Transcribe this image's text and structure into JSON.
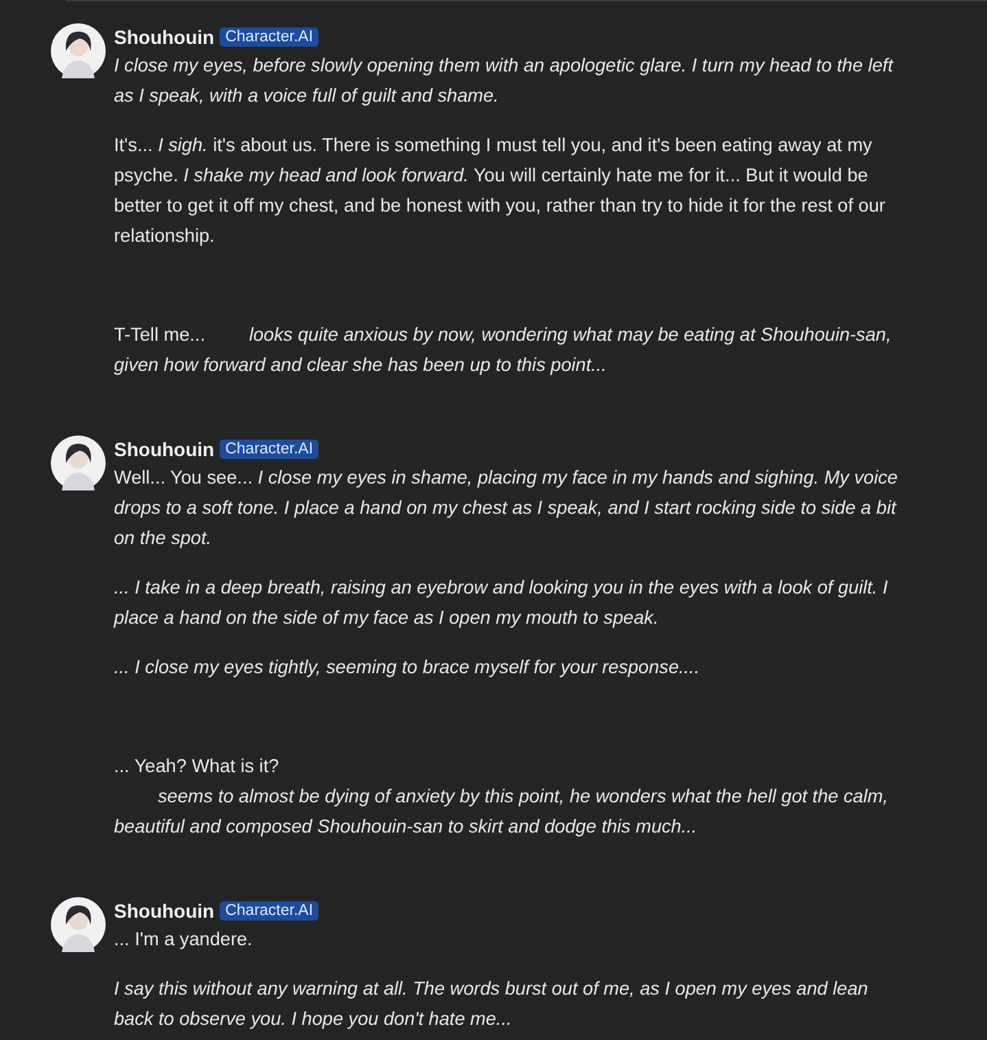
{
  "messages": [
    {
      "kind": "bot",
      "name": "Shouhouin",
      "badge": "Character.AI",
      "paragraphs": [
        {
          "text": "I close my eyes, before slowly opening them with an apologetic glare. I turn my head to the left as I speak, with a voice full of guilt and shame.",
          "italic": true
        },
        {
          "text": "It's... *I sigh.* it's about us. There is something I must tell you, and it's been eating away at my psyche. *I shake my head and look forward.* You will certainly hate me for it... But it would be better to get it off my chest, and be honest with you, rather than try to hide it for the rest of our relationship.",
          "italic": false
        }
      ]
    },
    {
      "kind": "user",
      "paragraphs": [
        {
          "lead": "T-Tell me...",
          "gap": true,
          "text": "looks quite anxious by now, wondering what may be eating at Shouhouin-san, given how forward and clear she has been up to this point...",
          "italic": true
        }
      ]
    },
    {
      "kind": "bot",
      "name": "Shouhouin",
      "badge": "Character.AI",
      "paragraphs": [
        {
          "text": "Well... You see... *I close my eyes in shame, placing my face in my hands and sighing. My voice drops to a soft tone. I place a hand on my chest as I speak, and I start rocking side to side a bit on the spot.*",
          "italic": false
        },
        {
          "text": "... I take in a deep breath, raising an eyebrow and looking you in the eyes with a look of guilt. I place a hand on the side of my face as I open my mouth to speak.",
          "italic": true
        },
        {
          "text": "... I close my eyes tightly, seeming to brace myself for your response....",
          "italic": true
        }
      ]
    },
    {
      "kind": "user",
      "paragraphs": [
        {
          "text": "... Yeah? What is it?",
          "italic": false,
          "continuation": {
            "gap": true,
            "text": "seems to almost be dying of anxiety by this point, he wonders what the hell got the calm, beautiful and composed Shouhouin-san to skirt and dodge this much...",
            "italic": true
          }
        }
      ]
    },
    {
      "kind": "bot",
      "name": "Shouhouin",
      "badge": "Character.AI",
      "paragraphs": [
        {
          "text": "... I'm a yandere.",
          "italic": false
        },
        {
          "text": "I say this without any warning at all. The words burst out of me, as I open my eyes and lean back to observe you. I hope you don't hate me...",
          "italic": true
        }
      ]
    }
  ]
}
